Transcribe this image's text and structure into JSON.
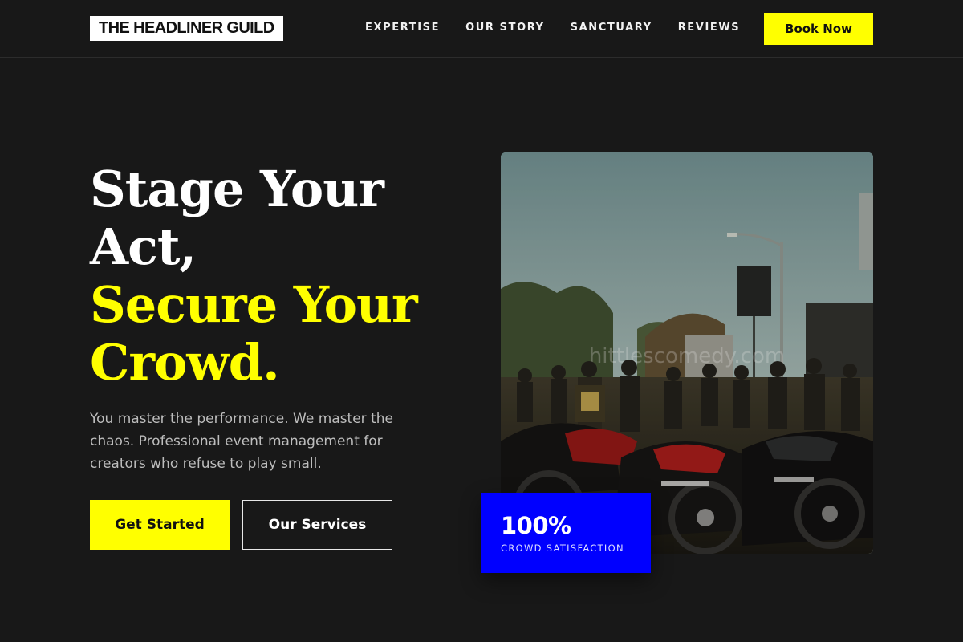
{
  "header": {
    "logo": "THE HEADLINER GUILD",
    "nav": [
      {
        "label": "EXPERTISE"
      },
      {
        "label": "OUR STORY"
      },
      {
        "label": "SANCTUARY"
      },
      {
        "label": "REVIEWS"
      }
    ],
    "book_button": "Book Now"
  },
  "hero": {
    "title_white": [
      "Stage Your",
      "Act,"
    ],
    "title_yellow": [
      "Secure Your",
      "Crowd."
    ],
    "description": "You master the performance. We master the chaos. Professional event management for creators who refuse to play small.",
    "primary_cta": "Get Started",
    "secondary_cta": "Our Services",
    "image": {
      "watermark": "hittlescomedy.com"
    },
    "stat": {
      "value": "100%",
      "label": "CROWD SATISFACTION"
    }
  },
  "colors": {
    "background": "#181818",
    "accent": "#ffff00",
    "stat_badge": "#0000ff",
    "text": "#ffffff"
  },
  "icons": {
    "logo": "wordmark",
    "hero_image": "motorcycle-rally-photo"
  }
}
